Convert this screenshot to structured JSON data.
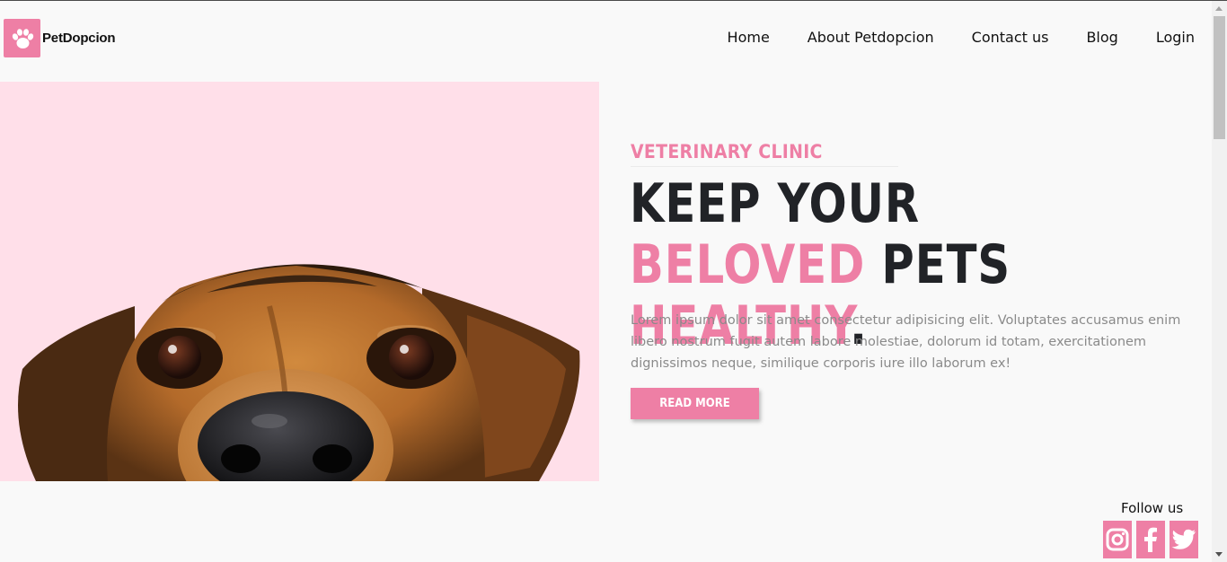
{
  "brand": {
    "name": "PetDopcion",
    "icon": "paw-icon",
    "color": "#ee7fa5"
  },
  "nav": [
    {
      "label": "Home"
    },
    {
      "label": "About Petdopcion"
    },
    {
      "label": "Contact us"
    },
    {
      "label": "Blog"
    },
    {
      "label": "Login"
    }
  ],
  "hero": {
    "image": "dog-peeking-photo",
    "eyebrow": "Veterinary Clinic",
    "headline_1": "KEEP YOUR ",
    "headline_highlight": "BELOVED",
    "headline_2": " PETS",
    "headline_3": "HEALTHY",
    "headline_end": ".",
    "description": "Lorem ipsum dolor sit amet consectetur adipisicing elit. Voluptates accusamus enim libero nostrum fugit autem labore molestiae, dolorum id totam, exercitationem dignissimos neque, similique corporis iure illo laborum ex!",
    "button_label": "Read more"
  },
  "social": {
    "title": "Follow us",
    "icons": [
      "instagram-icon",
      "facebook-icon",
      "twitter-icon"
    ]
  }
}
